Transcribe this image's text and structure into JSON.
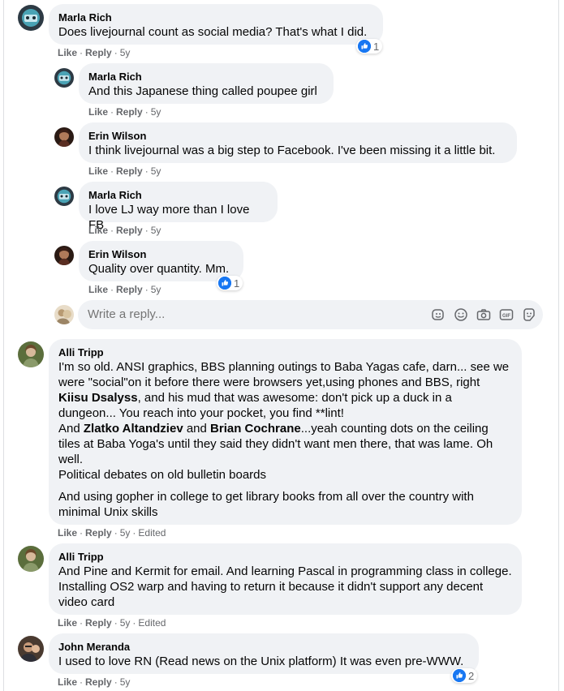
{
  "colors": {
    "bubble": "#f0f2f5",
    "like_blue": "#1877f2",
    "meta_gray": "#65676b"
  },
  "actions": {
    "like": "Like",
    "reply": "Reply",
    "sep": "·"
  },
  "comments": [
    {
      "author": "Marla Rich",
      "text": "Does livejournal count as social media? That's what I did.",
      "time": "5y",
      "reactions": "1"
    },
    {
      "author": "Marla Rich",
      "text": "And this Japanese thing called poupee girl",
      "time": "5y"
    },
    {
      "author": "Erin Wilson",
      "text": "I think livejournal was a big step to Facebook. I've been missing it a little bit.",
      "time": "5y"
    },
    {
      "author": "Marla Rich",
      "text": "I love LJ way more than I love FB",
      "time": "5y"
    },
    {
      "author": "Erin Wilson",
      "text": "Quality over quantity. Mm.",
      "time": "5y",
      "reactions": "1"
    },
    {
      "author": "Alli Tripp",
      "text_parts": {
        "p1": "I'm so old. ANSI graphics, BBS planning outings to Baba Yagas cafe, darn... see we were \"social\"on it before there were browsers yet,using phones and BBS, right ",
        "mention1": "Kiisu Dsalyss",
        "p2": ", and his mud that was awesome: don't pick up a duck in a dungeon... You reach into your pocket, you find **lint!",
        "p3": "And ",
        "mention2": "Zlatko Altandziev",
        "p4": " and ",
        "mention3": "Brian Cochrane",
        "p5": "...yeah counting dots on the ceiling tiles at Baba Yoga's until they said they didn't want men there, that was lame. Oh well.",
        "p6": "Political debates on old bulletin boards",
        "p7": "And using gopher in college to get library books from all over the country with minimal Unix skills"
      },
      "time": "5y",
      "edited": "Edited"
    },
    {
      "author": "Alli Tripp",
      "text": "And Pine and Kermit for email. And learning Pascal in programming class in college. Installing OS2 warp and having to return it because it didn't support any decent video card",
      "time": "5y",
      "edited": "Edited"
    },
    {
      "author": "John Meranda",
      "text": "I used to love RN (Read news on the Unix platform) It was even pre-WWW.",
      "time": "5y",
      "reactions": "2"
    }
  ],
  "reply_box": {
    "placeholder": "Write a reply..."
  }
}
